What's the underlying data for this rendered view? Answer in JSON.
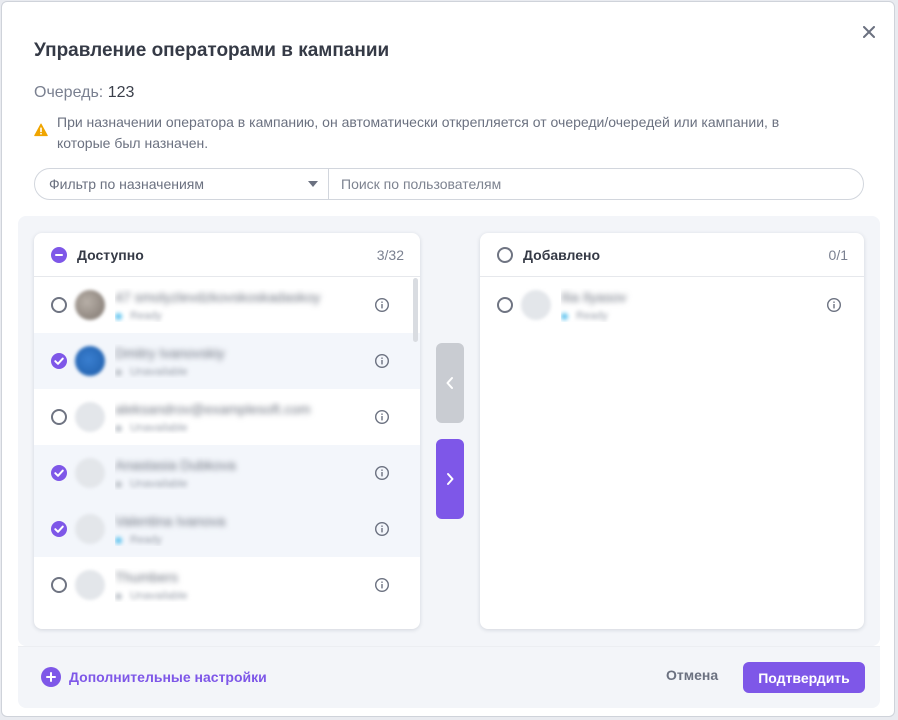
{
  "dialog": {
    "title": "Управление операторами в кампании",
    "queue_label": "Очередь:",
    "queue_value": "123",
    "warning_text": "При назначении оператора в кампанию, он автоматически открепляется от очереди/очередей или кампании, в которые был назначен."
  },
  "filters": {
    "assignment_filter": "Фильтр по назначениям",
    "search_placeholder": "Поиск по пользователям"
  },
  "available": {
    "title": "Доступно",
    "count": "3/32",
    "select_state": "partial",
    "items": [
      {
        "name": "47 smolyzlevdzkovskoskadaskoy",
        "status": "online",
        "sub": "Ready",
        "avatar": "photo",
        "checked": false
      },
      {
        "name": "Dmitry Ivanovskiy",
        "status": "offline",
        "sub": "Unavailable",
        "avatar": "blue",
        "checked": true
      },
      {
        "name": "aleksandrov@examplesoft.com",
        "status": "offline",
        "sub": "Unavailable",
        "avatar": "default",
        "checked": false
      },
      {
        "name": "Anastasia Dubkova",
        "status": "offline",
        "sub": "Unavailable",
        "avatar": "default",
        "checked": true
      },
      {
        "name": "Valentina Ivanova",
        "status": "online",
        "sub": "Ready",
        "avatar": "default",
        "checked": true
      },
      {
        "name": "Thumbers",
        "status": "offline",
        "sub": "Unavailable",
        "avatar": "default",
        "checked": false
      }
    ]
  },
  "added": {
    "title": "Добавлено",
    "count": "0/1",
    "items": [
      {
        "name": "Ilia Ilyasov",
        "status": "online",
        "sub": "Ready",
        "avatar": "default",
        "checked": false
      }
    ]
  },
  "footer": {
    "more_settings": "Дополнительные настройки",
    "cancel": "Отмена",
    "confirm": "Подтвердить"
  },
  "colors": {
    "accent": "#7e57e8",
    "warning": "#f0a500",
    "online": "#5cc2ee"
  },
  "icons": {
    "close": "close-icon",
    "warning": "warning-icon",
    "info": "info-icon",
    "arrow_left": "chevron-left-icon",
    "arrow_right": "chevron-right-icon",
    "plus": "plus-icon"
  }
}
